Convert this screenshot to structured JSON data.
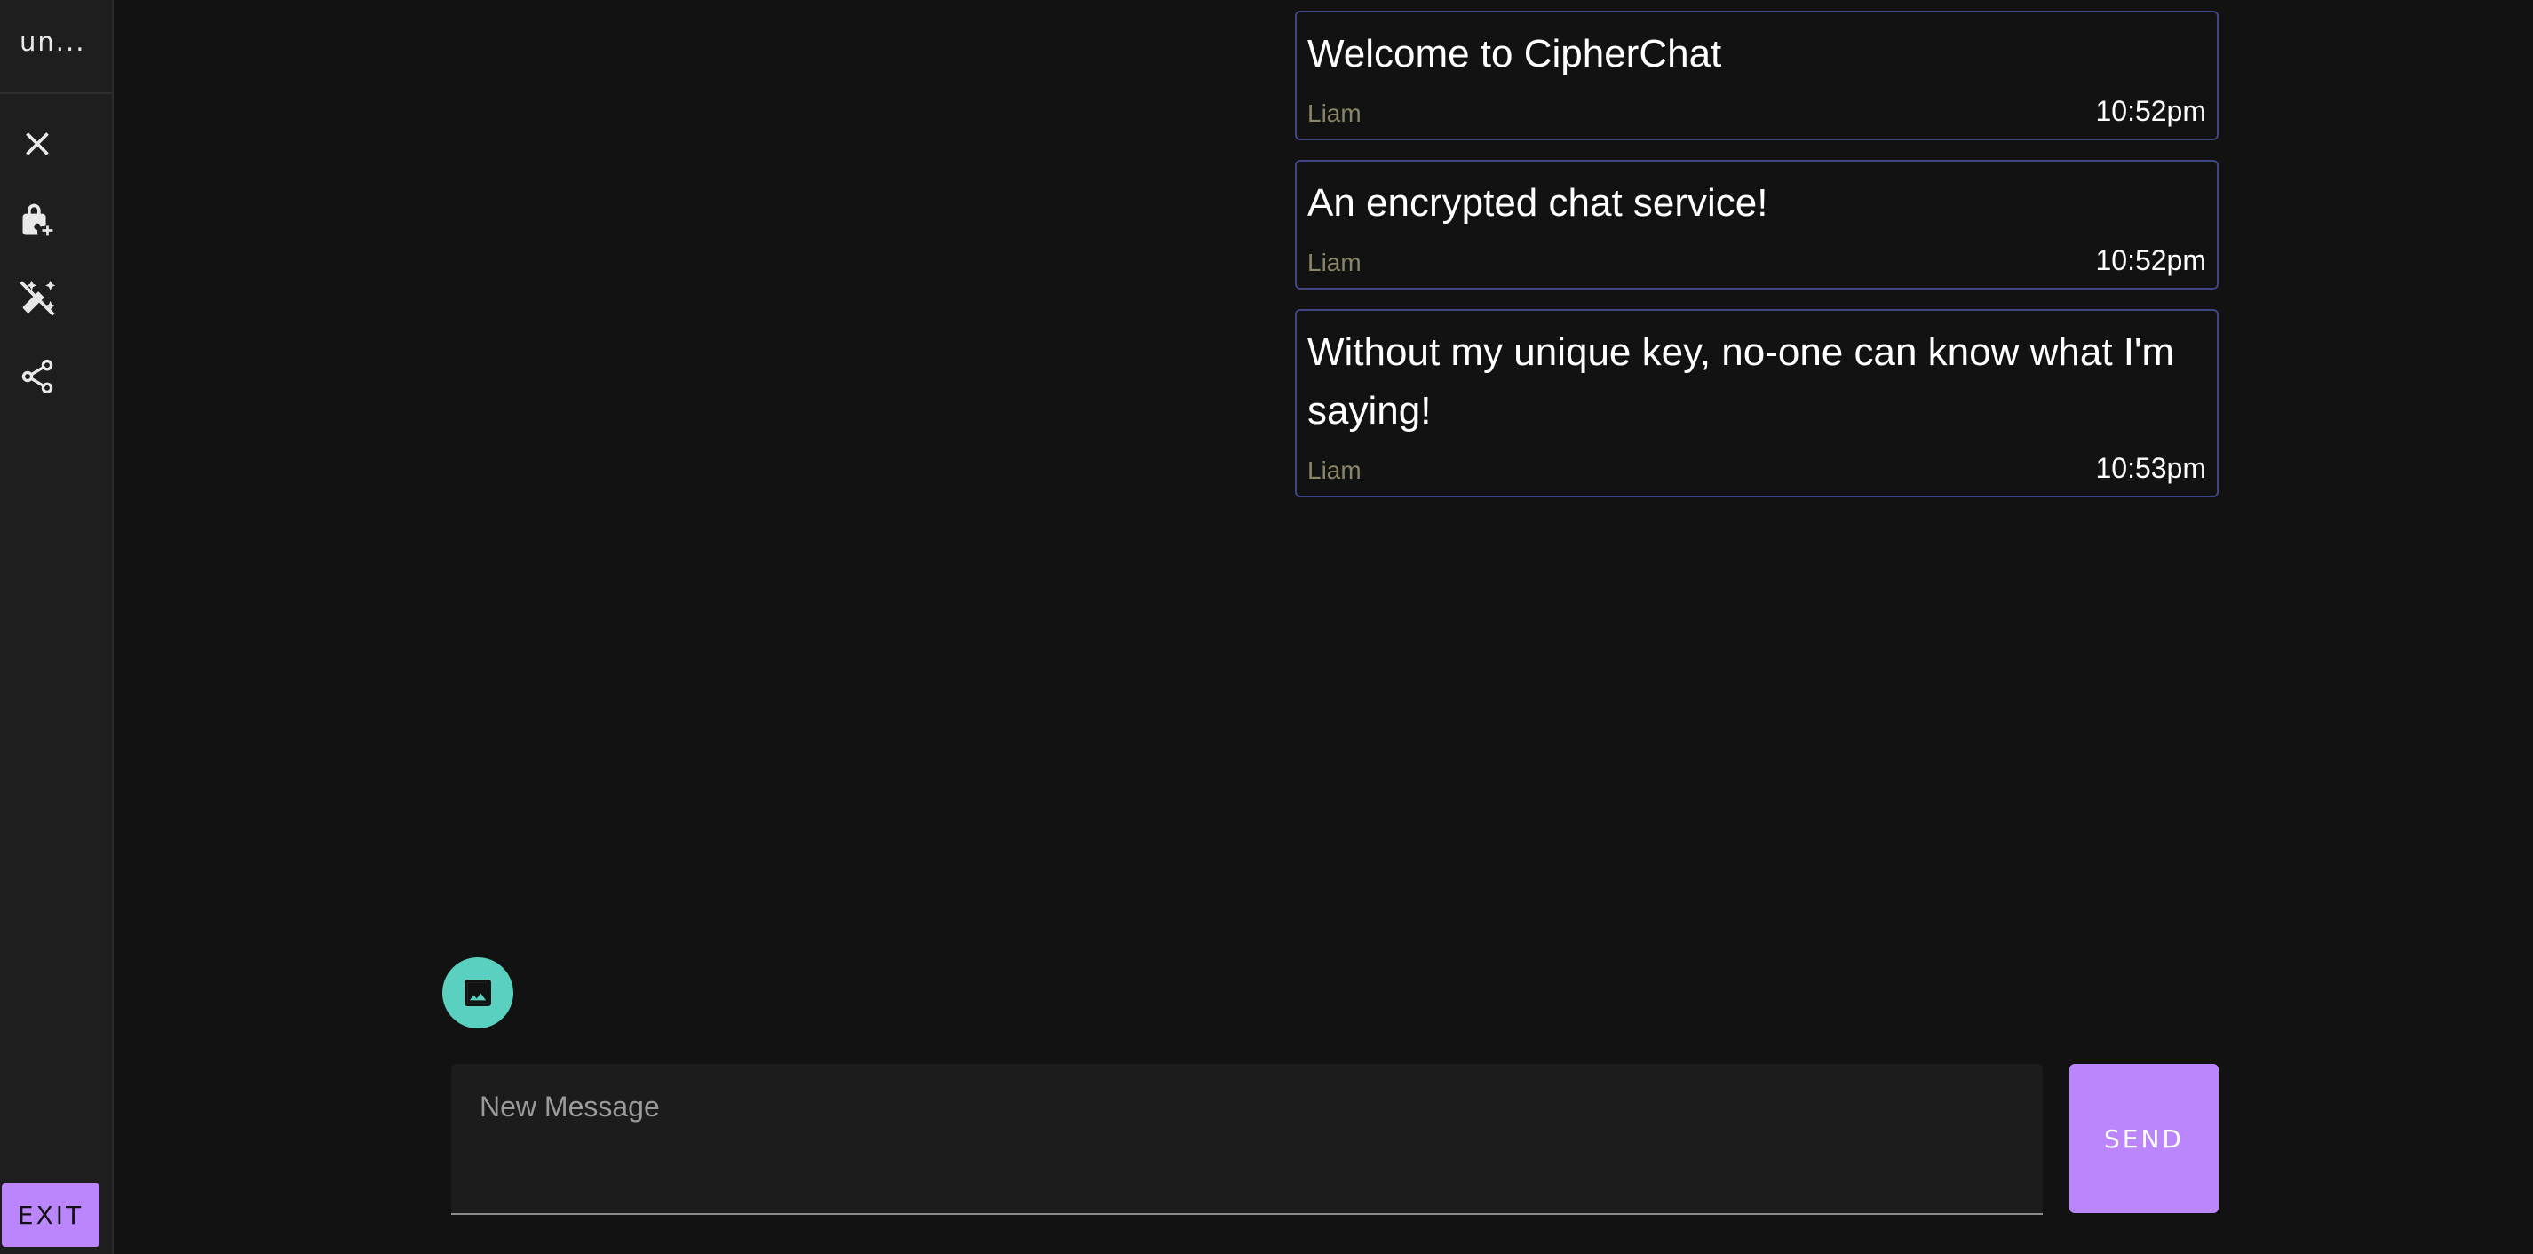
{
  "sidebar": {
    "room_name": "un...",
    "icons": [
      "close-icon",
      "lock-add-icon",
      "auto-fix-off-icon",
      "share-icon"
    ],
    "exit_label": "EXIT"
  },
  "messages": [
    {
      "text": "Welcome to CipherChat",
      "author": "Liam",
      "time": "10:52pm"
    },
    {
      "text": "An encrypted chat service!",
      "author": "Liam",
      "time": "10:52pm"
    },
    {
      "text": "Without my unique key, no-one can know what I'm saying!",
      "author": "Liam",
      "time": "10:53pm"
    }
  ],
  "composer": {
    "placeholder": "New Message",
    "value": "",
    "send_label": "SEND"
  },
  "colors": {
    "background": "#121212",
    "sidebar": "#1e1e1e",
    "accent": "#bb86fc",
    "fab": "#5ad1c0",
    "message_border": "#3f4683",
    "author": "#8a8566"
  }
}
